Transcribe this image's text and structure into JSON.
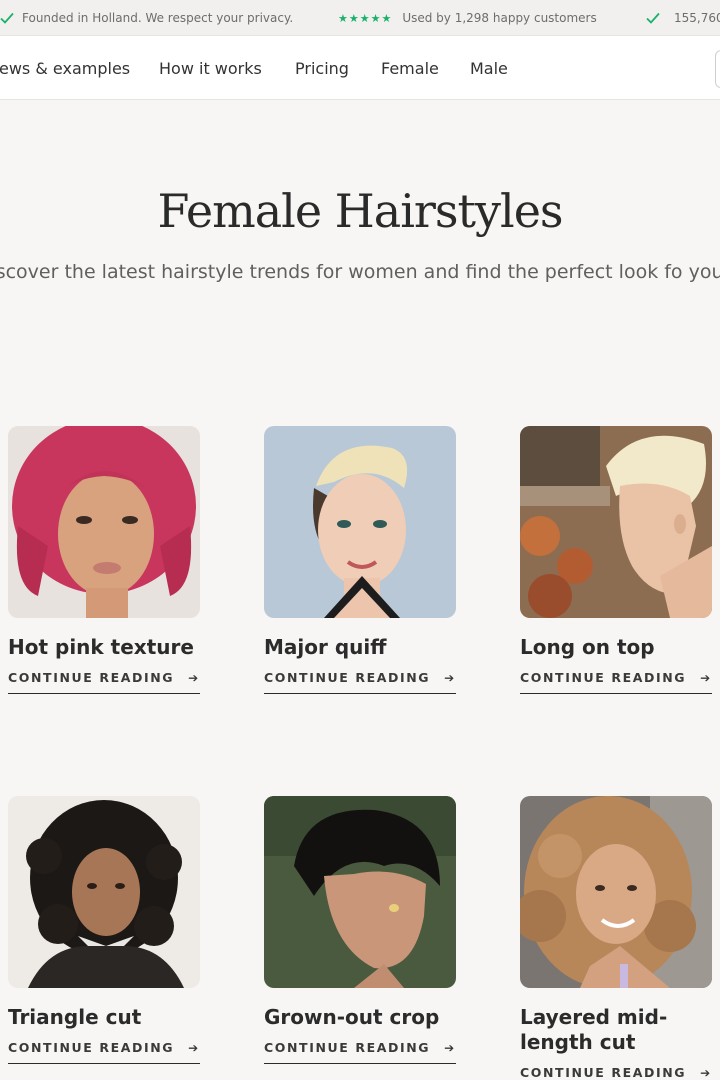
{
  "trustbar": {
    "item1": "Founded in Holland. We respect your privacy.",
    "stars": "★★★★★",
    "item2": "Used by 1,298 happy customers",
    "item3": "155,760"
  },
  "nav": {
    "items": [
      "ews & examples",
      "How it works",
      "Pricing",
      "Female",
      "Male"
    ]
  },
  "hero": {
    "title": "Female Hairstyles",
    "subtitle": "iscover the latest hairstyle trends for women and find the perfect look fo you."
  },
  "cards": [
    {
      "title": "Hot pink texture",
      "cta": "CONTINUE READING"
    },
    {
      "title": "Major quiff",
      "cta": "CONTINUE READING"
    },
    {
      "title": "Long on top",
      "cta": "CONTINUE READING"
    },
    {
      "title": "Triangle cut",
      "cta": "CONTINUE READING"
    },
    {
      "title": "Grown-out crop",
      "cta": "CONTINUE READING"
    },
    {
      "title": "Layered mid-length cut",
      "cta": "CONTINUE READING"
    }
  ],
  "colors": {
    "accent_green": "#17b26a",
    "background": "#f7f6f4",
    "text": "#2b2b2b"
  }
}
